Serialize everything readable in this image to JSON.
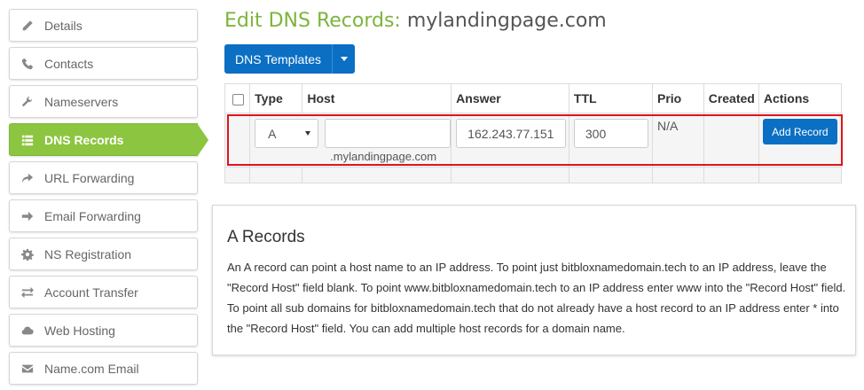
{
  "sidebar": {
    "items": [
      {
        "label": "Details",
        "icon": "pencil-icon"
      },
      {
        "label": "Contacts",
        "icon": "phone-icon"
      },
      {
        "label": "Nameservers",
        "icon": "wrench-icon"
      },
      {
        "label": "DNS Records",
        "icon": "list-icon",
        "active": true
      },
      {
        "label": "URL Forwarding",
        "icon": "share-arrow-icon"
      },
      {
        "label": "Email Forwarding",
        "icon": "arrow-right-icon"
      },
      {
        "label": "NS Registration",
        "icon": "gear-icon"
      },
      {
        "label": "Account Transfer",
        "icon": "transfer-icon"
      },
      {
        "label": "Web Hosting",
        "icon": "cloud-icon"
      },
      {
        "label": "Name.com Email",
        "icon": "envelope-icon"
      }
    ]
  },
  "header": {
    "title_prefix": "Edit DNS Records:",
    "domain": "mylandingpage.com"
  },
  "toolbar": {
    "templates_label": "DNS Templates"
  },
  "table": {
    "columns": [
      "Type",
      "Host",
      "Answer",
      "TTL",
      "Prio",
      "Created",
      "Actions"
    ],
    "edit_row": {
      "type_value": "A",
      "host_value": "",
      "host_suffix": ".mylandingpage.com",
      "answer_value": "162.243.77.151",
      "ttl_value": "300",
      "prio_value": "N/A",
      "created_value": "",
      "action_label": "Add Record"
    }
  },
  "info": {
    "heading": "A Records",
    "body": "An A record can point a host name to an IP address. To point just bitbloxnamedomain.tech to an IP address, leave the \"Record Host\" field blank. To point www.bitbloxnamedomain.tech to an IP address enter www into the \"Record Host\" field. To point all sub domains for bitbloxnamedomain.tech that do not already have a host record to an IP address enter * into the \"Record Host\" field. You can add multiple host records for a domain name."
  },
  "colors": {
    "accent_green": "#8cc53f",
    "title_green": "#7db43c",
    "primary_blue": "#0b6fc4",
    "highlight_red": "#e0141e"
  }
}
